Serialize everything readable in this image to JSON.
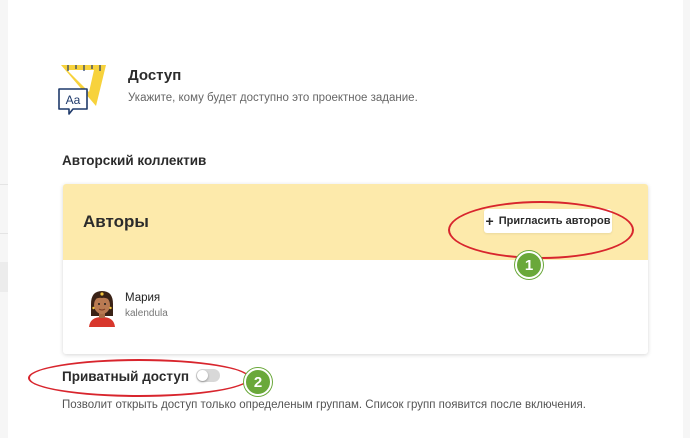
{
  "access": {
    "title": "Доступ",
    "description": "Укажите, кому будет доступно это проектное задание.",
    "logo_text": "Aa"
  },
  "authors_section": {
    "label": "Авторский коллектив",
    "card_title": "Авторы",
    "invite_plus": "+",
    "invite_label": "Пригласить авторов",
    "authors": [
      {
        "name": "Мария",
        "login": "kalendula"
      }
    ]
  },
  "private_access": {
    "label": "Приватный доступ",
    "enabled": false,
    "description": "Позволит открыть доступ только определеным группам. Список групп появится после включения."
  },
  "annotations": {
    "marker_1": "1",
    "marker_2": "2"
  },
  "colors": {
    "card_header": "#fdeaab",
    "logo_yellow": "#f7d23c",
    "logo_navy": "#1f3a6b",
    "annotation_red": "#d8252d",
    "marker_green": "#6aa83a",
    "toggle_off": "#d8d8d8"
  }
}
